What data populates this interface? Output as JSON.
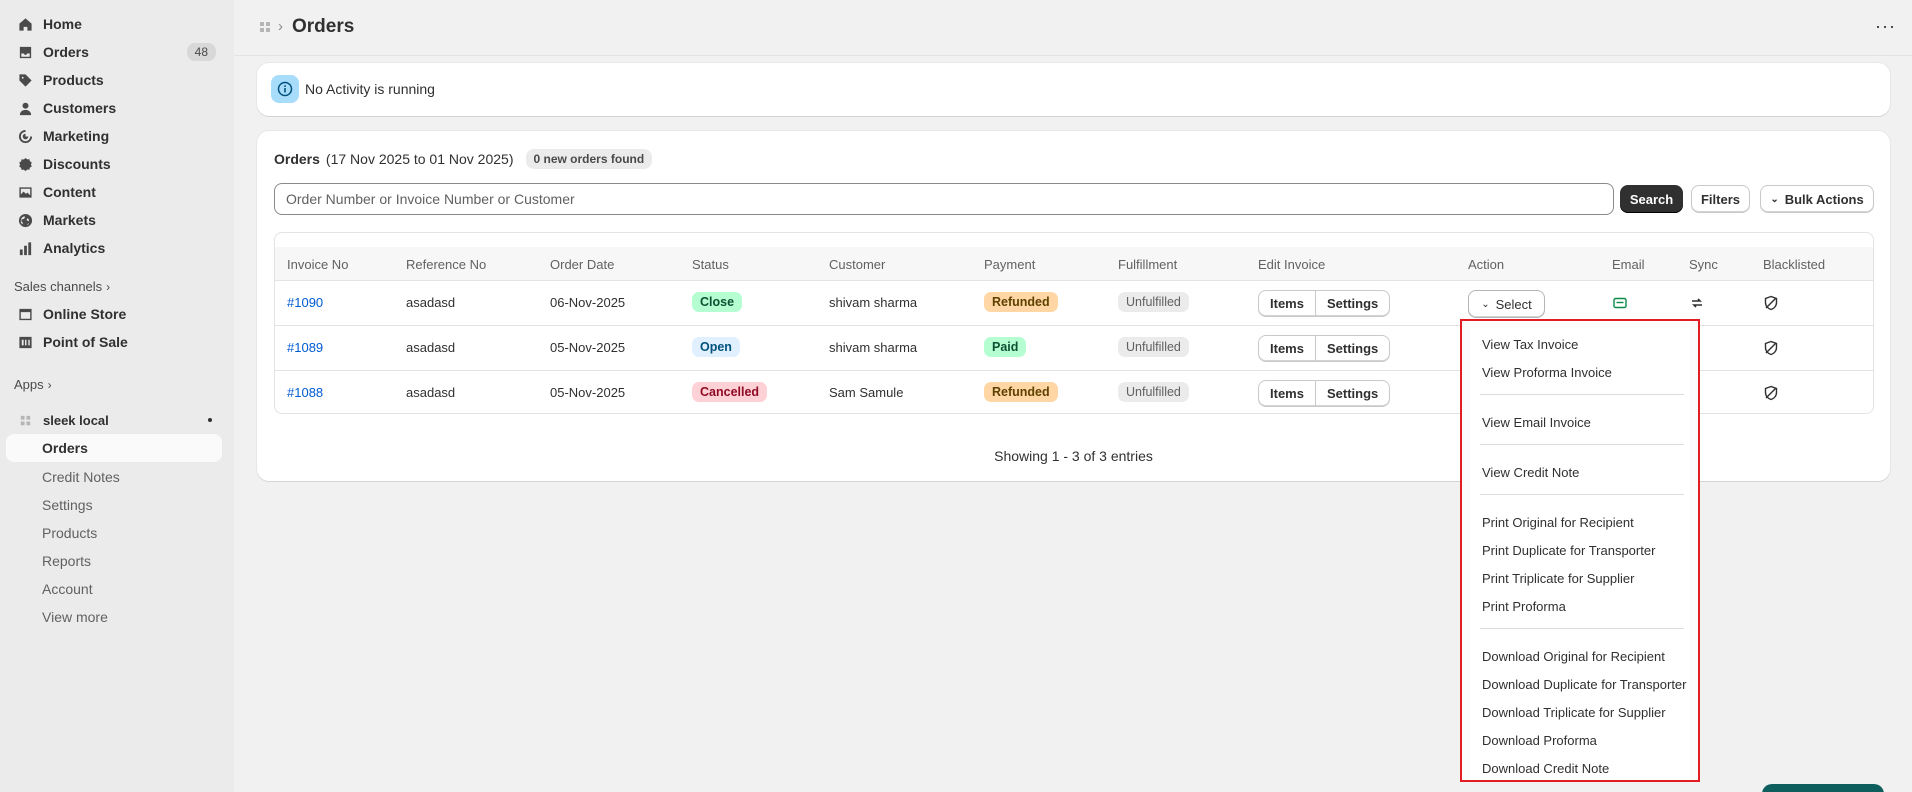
{
  "sidebar": {
    "items": [
      {
        "label": "Home",
        "icon": "home-icon"
      },
      {
        "label": "Orders",
        "icon": "inbox-icon",
        "badge": "48"
      },
      {
        "label": "Products",
        "icon": "tag-icon"
      },
      {
        "label": "Customers",
        "icon": "person-icon"
      },
      {
        "label": "Marketing",
        "icon": "target-icon"
      },
      {
        "label": "Discounts",
        "icon": "discount-icon"
      },
      {
        "label": "Content",
        "icon": "content-icon"
      },
      {
        "label": "Markets",
        "icon": "globe-icon"
      },
      {
        "label": "Analytics",
        "icon": "bar-chart-icon"
      }
    ],
    "sales_channels_label": "Sales channels",
    "channels": [
      {
        "label": "Online Store",
        "icon": "store-icon"
      },
      {
        "label": "Point of Sale",
        "icon": "pos-icon"
      }
    ],
    "apps_label": "Apps",
    "app_name": "sleek local",
    "app_sub": [
      "Orders",
      "Credit Notes",
      "Settings",
      "Products",
      "Reports",
      "Account",
      "View more"
    ]
  },
  "header": {
    "title": "Orders",
    "separator": "›",
    "more": "···"
  },
  "banner": {
    "text": "No Activity is running"
  },
  "orders": {
    "heading": "Orders",
    "range": "(17 Nov 2025 to 01 Nov 2025)",
    "new_orders": "0 new orders found",
    "search_placeholder": "Order Number or Invoice Number or Customer",
    "search_label": "Search",
    "filters_label": "Filters",
    "bulk_label": "Bulk Actions",
    "columns": [
      "Invoice No",
      "Reference No",
      "Order Date",
      "Status",
      "Customer",
      "Payment",
      "Fulfillment",
      "Edit Invoice",
      "Action",
      "Email",
      "Sync",
      "Blacklisted"
    ],
    "rows": [
      {
        "invoice": "#1090",
        "ref": "asadasd",
        "date": "06-Nov-2025",
        "status": "Close",
        "customer": "shivam sharma",
        "payment": "Refunded",
        "fulfillment": "Unfulfilled",
        "items": "Items",
        "settings": "Settings",
        "action": "Select"
      },
      {
        "invoice": "#1089",
        "ref": "asadasd",
        "date": "05-Nov-2025",
        "status": "Open",
        "customer": "shivam sharma",
        "payment": "Paid",
        "fulfillment": "Unfulfilled",
        "items": "Items",
        "settings": "Settings"
      },
      {
        "invoice": "#1088",
        "ref": "asadasd",
        "date": "05-Nov-2025",
        "status": "Cancelled",
        "customer": "Sam Samule",
        "payment": "Refunded",
        "fulfillment": "Unfulfilled",
        "items": "Items",
        "settings": "Settings"
      }
    ],
    "showing": "Showing 1 - 3 of 3 entries"
  },
  "dropdown": {
    "groups": [
      [
        "View Tax Invoice",
        "View Proforma Invoice"
      ],
      [
        "View Email Invoice"
      ],
      [
        "View Credit Note"
      ],
      [
        "Print Original for Recipient",
        "Print Duplicate for Transporter",
        "Print Triplicate for Supplier",
        "Print Proforma"
      ],
      [
        "Download Original for Recipient",
        "Download Duplicate for Transporter",
        "Download Triplicate for Supplier",
        "Download Proforma",
        "Download Credit Note"
      ]
    ]
  },
  "colors": {
    "close_bg": "#b4fed2",
    "close_fg": "#0c5132",
    "open_bg": "#e0f0ff",
    "open_fg": "#00527c",
    "cancelled_bg": "#fed1d7",
    "cancelled_fg": "#8e0b21",
    "refunded_bg": "#ffd6a4",
    "refunded_fg": "#5e4200",
    "paid_bg": "#b4fed2",
    "paid_fg": "#0c5132",
    "unfulfilled_bg": "#ebebeb",
    "unfulfilled_fg": "#616161",
    "highlight": "#e31b23"
  }
}
